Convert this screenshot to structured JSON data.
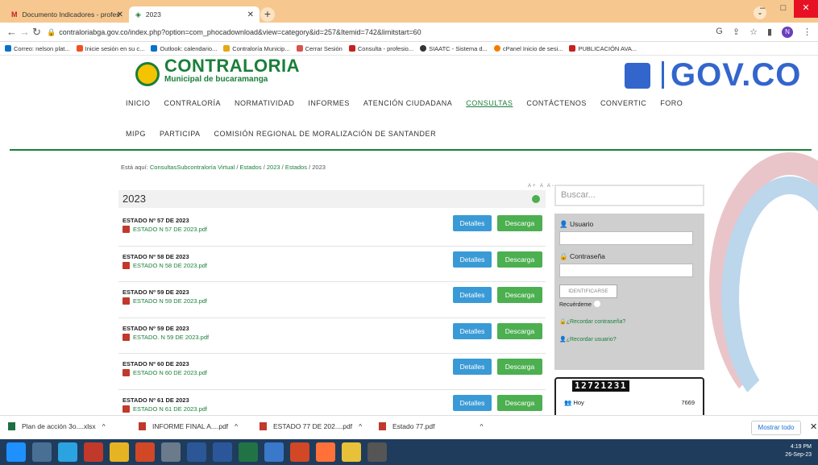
{
  "browser": {
    "tabs": [
      {
        "label": "Documento Indicadores - profes",
        "active": false
      },
      {
        "label": "2023",
        "active": true
      }
    ],
    "new_tab": "+",
    "url": "contraloriabga.gov.co/index.php?option=com_phocadownload&view=category&id=257&Itemid=742&limitstart=60",
    "profile_initial": "N",
    "bookmarks": [
      "Correo: nelson plat...",
      "Inicie sesión en su c...",
      "Outlook: calendario...",
      "Contraloría Municip...",
      "Cerrar Sesión",
      "Consulta - profesio...",
      "SIAATC - Sistema d...",
      "cPanel Inicio de sesi...",
      "PUBLICACIÓN AVA..."
    ]
  },
  "site": {
    "logo_title": "CONTRALORIA",
    "logo_subtitle": "Municipal de bucaramanga",
    "gov_logo": "GOV.CO",
    "nav": [
      "INICIO",
      "CONTRALORÍA",
      "NORMATIVIDAD",
      "INFORMES",
      "ATENCIÓN CIUDADANA",
      "CONSULTAS",
      "CONTÁCTENOS",
      "CONVERTIC",
      "FORO",
      "MIPG",
      "PARTICIPA",
      "COMISIÓN REGIONAL DE MORALIZACIÓN DE SANTANDER"
    ],
    "nav_selected": "CONSULTAS"
  },
  "breadcrumb": {
    "prefix": "Está aquí: ",
    "items": [
      "Consultas",
      "Subcontraloría Virtual",
      "Estados",
      "2023",
      "Estados",
      "2023"
    ],
    "separator": "/"
  },
  "font_controls": "A+ A A-",
  "category_title": "2023",
  "documents": [
    {
      "title": "ESTADO Nº 57 DE 2023",
      "file": "ESTADO N 57 DE 2023.pdf"
    },
    {
      "title": "ESTADO Nº 58 DE 2023",
      "file": "ESTADO N 58 DE 2023.pdf"
    },
    {
      "title": "ESTADO Nº 59 DE 2023",
      "file": "ESTADO N 59 DE 2023.pdf"
    },
    {
      "title": "ESTADO Nº 59 DE 2023",
      "file": "ESTADO. N 59 DE 2023.pdf"
    },
    {
      "title": "ESTADO Nº 60 DE 2023",
      "file": "ESTADO N 60 DE 2023.pdf"
    },
    {
      "title": "ESTADO Nº 61 DE 2023",
      "file": "ESTADO N 61 DE 2023.pdf"
    }
  ],
  "buttons": {
    "details": "Detalles",
    "download": "Descarga"
  },
  "sidebar": {
    "search_placeholder": "Buscar...",
    "user_label": "Usuario",
    "password_label": "Contraseña",
    "login_button": "IDENTIFICARSE",
    "remember": "Recuérdeme",
    "forgot_password": "¿Recordar contraseña?",
    "forgot_user": "¿Recordar usuario?",
    "counter_digits": "12721231",
    "today_label": "Hoy",
    "today_value": "7669"
  },
  "downloads": {
    "items": [
      "Plan de acción 3o....xlsx",
      "INFORME FINAL A....pdf",
      "ESTADO 77 DE 202....pdf",
      "Estado 77.pdf"
    ],
    "show_all": "Mostrar todo"
  },
  "taskbar": {
    "time": "4:19 PM",
    "date": "26-Sep-23"
  }
}
